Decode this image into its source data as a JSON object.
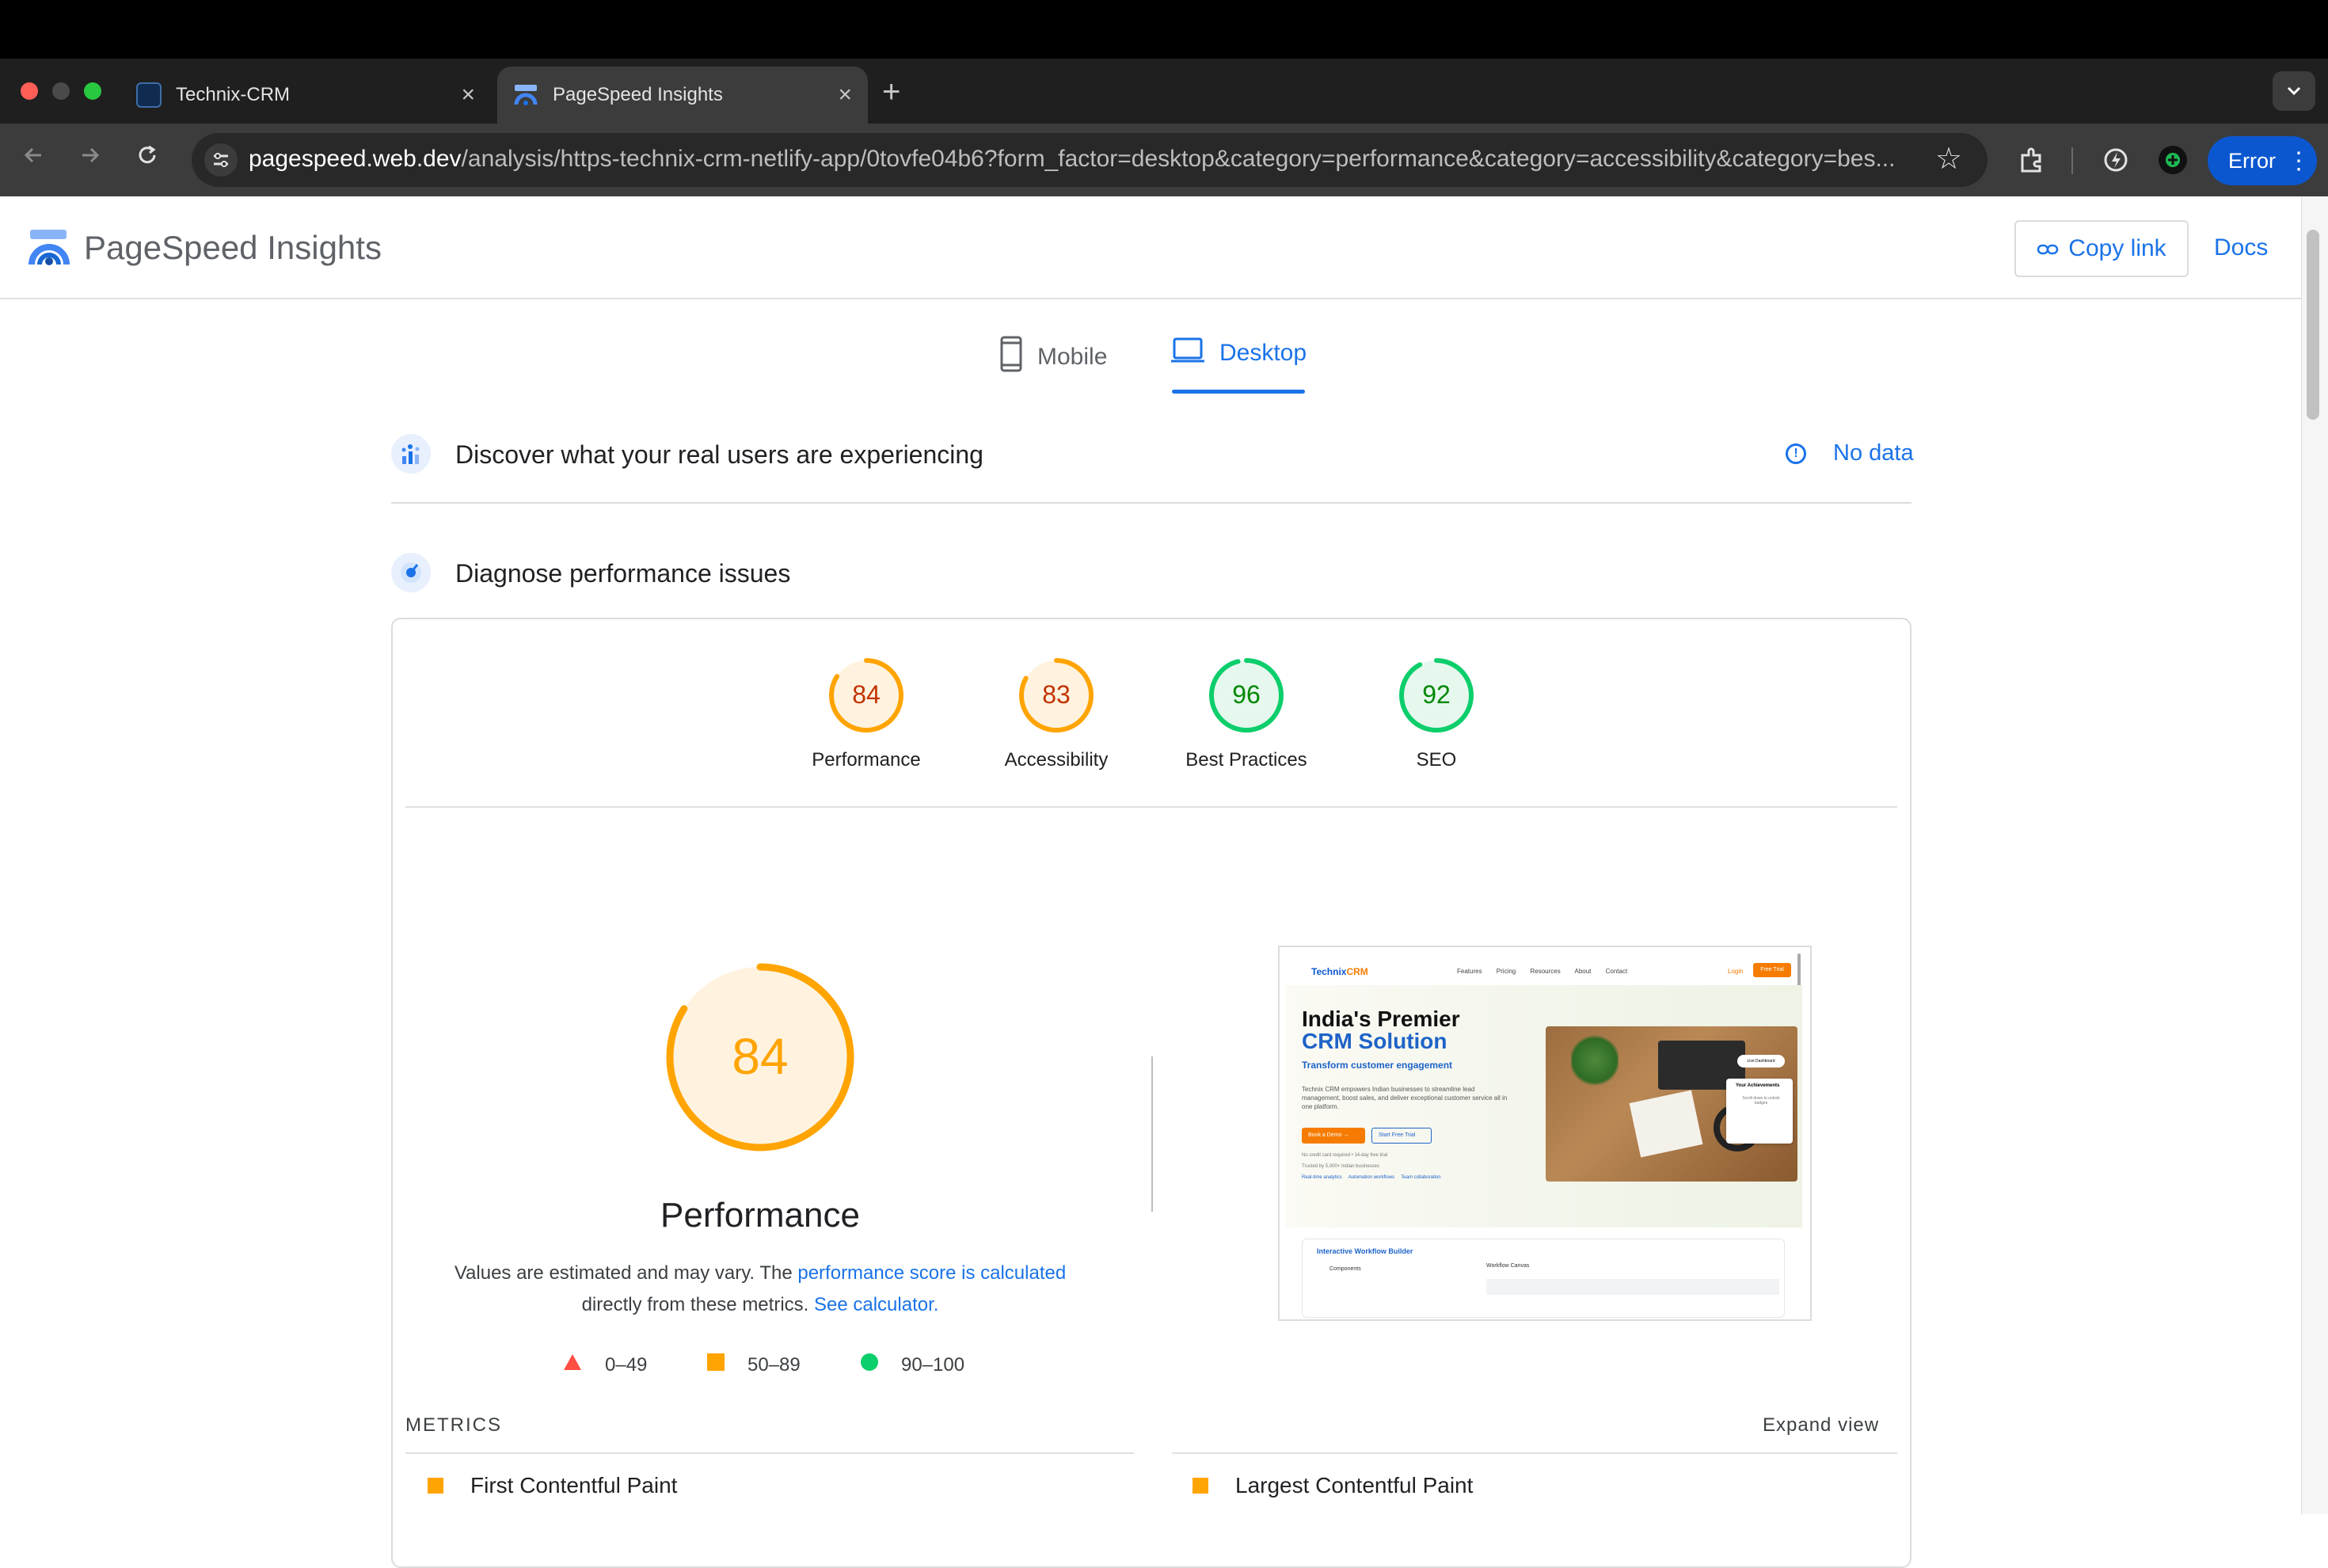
{
  "browser": {
    "tabs": [
      {
        "title": "Technix-CRM",
        "favicon_color": "#1a3d6d"
      },
      {
        "title": "PageSpeed Insights",
        "favicon_color": "#4285f4"
      }
    ],
    "new_tab": "+",
    "tab_dropdown": "⌄",
    "url_host": "pagespeed.web.dev",
    "url_rest": "/analysis/https-technix-crm-netlify-app/0tovfe04b6?form_factor=desktop&category=performance&category=accessibility&category=bes...",
    "profile_button": "Error",
    "icons": [
      "back-icon",
      "forward-icon",
      "reload-icon",
      "site-settings-icon",
      "bookmark-star-icon",
      "extensions-icon",
      "performance-icon",
      "extension-green-icon"
    ]
  },
  "header": {
    "logo_text": "PageSpeed Insights",
    "copy_link": "Copy link",
    "docs": "Docs"
  },
  "device_tabs": {
    "mobile": "Mobile",
    "desktop": "Desktop",
    "selected": "Desktop"
  },
  "field_data": {
    "title": "Discover what your real users are experiencing",
    "status": "No data"
  },
  "lab_data": {
    "title": "Diagnose performance issues"
  },
  "scores": [
    {
      "label": "Performance",
      "score": 84,
      "color": "#ffa400",
      "text_color": "#c33300"
    },
    {
      "label": "Accessibility",
      "score": 83,
      "color": "#ffa400",
      "text_color": "#c33300"
    },
    {
      "label": "Best Practices",
      "score": 96,
      "color": "#0cce6b",
      "text_color": "#008800"
    },
    {
      "label": "SEO",
      "score": 92,
      "color": "#0cce6b",
      "text_color": "#008800"
    }
  ],
  "performance": {
    "score": 84,
    "title": "Performance",
    "note_1": "Values are estimated and may vary. The ",
    "note_link_1": "performance score is calculated",
    "note_2": "directly from these metrics. ",
    "note_link_2": "See calculator.",
    "legend": [
      {
        "range": "0–49",
        "color": "#ff4e42",
        "shape": "triangle"
      },
      {
        "range": "50–89",
        "color": "#ffa400",
        "shape": "square"
      },
      {
        "range": "90–100",
        "color": "#0cce6b",
        "shape": "circle"
      }
    ]
  },
  "screenshot": {
    "logo_main": "Technix",
    "logo_accent": "CRM",
    "nav_links": "Features Pricing Resources About Contact",
    "login": "Login",
    "free_trial": "Free Trial",
    "headline_1": "India's Premier",
    "headline_2": "CRM Solution",
    "subheadline": "Transform customer engagement",
    "paragraph": "Technix CRM empowers Indian businesses to streamline lead management, boost sales, and deliver exceptional customer service all in one platform.",
    "demo_button": "Book a Demo →",
    "trial_button": "Start Free Trial",
    "small_1": "No credit card required • 14-day free trial",
    "small_2": "Trusted by 5,000+ Indian businesses",
    "features": "Real-time analytics     Automation workflows     Team collaboration",
    "live_badge": "Live Dashboard",
    "card_title": "Your Achievements",
    "card_text": "Scroll down to unlock badges",
    "builder_title": "Interactive Workflow Builder",
    "components": "Components",
    "canvas": "Workflow Canvas"
  },
  "metrics": {
    "label": "METRICS",
    "expand": "Expand view",
    "items": [
      {
        "name": "First Contentful Paint",
        "color": "#ffa400"
      },
      {
        "name": "Largest Contentful Paint",
        "color": "#ffa400"
      }
    ]
  }
}
